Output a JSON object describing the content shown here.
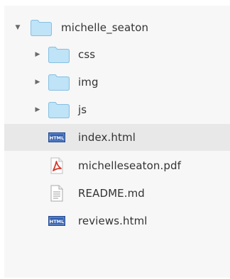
{
  "tree": {
    "root": {
      "label": "michelle_seaton",
      "expanded": true,
      "icon": "folder-icon"
    },
    "items": [
      {
        "label": "css",
        "type": "folder",
        "icon": "folder-icon"
      },
      {
        "label": "img",
        "type": "folder",
        "icon": "folder-icon"
      },
      {
        "label": "js",
        "type": "folder",
        "icon": "folder-icon"
      },
      {
        "label": "index.html",
        "type": "html",
        "icon": "html-file-icon",
        "selected": true
      },
      {
        "label": "michelleseaton.pdf",
        "type": "pdf",
        "icon": "pdf-file-icon"
      },
      {
        "label": "README.md",
        "type": "text",
        "icon": "text-file-icon"
      },
      {
        "label": "reviews.html",
        "type": "html",
        "icon": "html-file-icon"
      }
    ]
  },
  "icon_text": {
    "html_badge": "HTML"
  },
  "colors": {
    "folder_fill": "#bfe3f7",
    "folder_stroke": "#86bfe2",
    "html_badge": "#2f5fb3",
    "pdf_red": "#d43a2f",
    "selected_bg": "#e8e8e8"
  }
}
